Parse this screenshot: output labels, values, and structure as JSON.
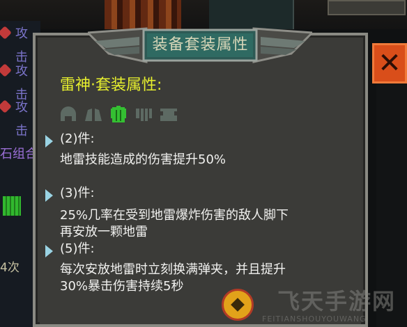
{
  "background": {
    "left_labels": [
      "攻击",
      "攻击",
      "攻击"
    ],
    "left_purple_label": "石组合",
    "left_count": "4次"
  },
  "tooltip": {
    "title": "装备套装属性",
    "set_name": "雷神·套装属性:",
    "set_icons": [
      "helmet-icon",
      "shoulder-icon",
      "armor-icon",
      "gloves-icon",
      "boots-icon"
    ],
    "active_piece_index": 2,
    "bonuses": [
      {
        "count": "(2)件:",
        "lines": [
          "地雷技能造成的伤害提升50%"
        ]
      },
      {
        "count": "(3)件:",
        "lines": [
          "25%几率在受到地雷爆炸伤害的敌人脚下",
          "再安放一颗地雷"
        ]
      },
      {
        "count": "(5)件:",
        "lines": [
          "每次安放地雷时立刻换满弹夹，并且提升",
          "30%暴击伤害持续5秒"
        ]
      }
    ]
  },
  "watermark": {
    "text": "飞天手游网",
    "sub": "FEITIANSHOUYOUWANG"
  },
  "colors": {
    "panel_bg": "#3a3a37",
    "title_text": "#d7d6b8",
    "set_name": "#e7ef2e",
    "body_text": "#f1f1ef",
    "marker": "#9ad3e3",
    "active_icon": "#34c032",
    "inactive_icon": "#5d6a63"
  }
}
